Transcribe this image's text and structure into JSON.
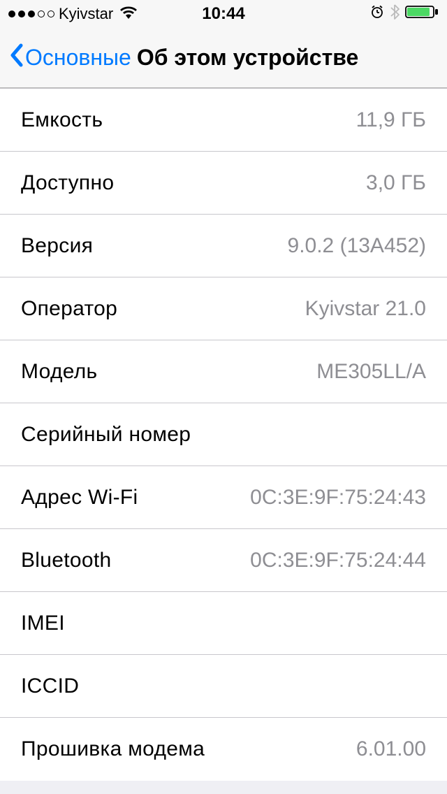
{
  "status_bar": {
    "carrier": "Kyivstar",
    "time": "10:44"
  },
  "nav": {
    "back_label": "Основные",
    "title": "Об этом устройстве"
  },
  "rows": {
    "capacity": {
      "label": "Емкость",
      "value": "11,9 ГБ"
    },
    "available": {
      "label": "Доступно",
      "value": "3,0 ГБ"
    },
    "version": {
      "label": "Версия",
      "value": "9.0.2 (13A452)"
    },
    "carrier": {
      "label": "Оператор",
      "value": "Kyivstar 21.0"
    },
    "model": {
      "label": "Модель",
      "value": "ME305LL/A"
    },
    "serial": {
      "label": "Серийный номер",
      "value": ""
    },
    "wifi": {
      "label": "Адрес Wi-Fi",
      "value": "0C:3E:9F:75:24:43"
    },
    "bluetooth": {
      "label": "Bluetooth",
      "value": "0C:3E:9F:75:24:44"
    },
    "imei": {
      "label": "IMEI",
      "value": ""
    },
    "iccid": {
      "label": "ICCID",
      "value": ""
    },
    "modem": {
      "label": "Прошивка модема",
      "value": "6.01.00"
    }
  }
}
